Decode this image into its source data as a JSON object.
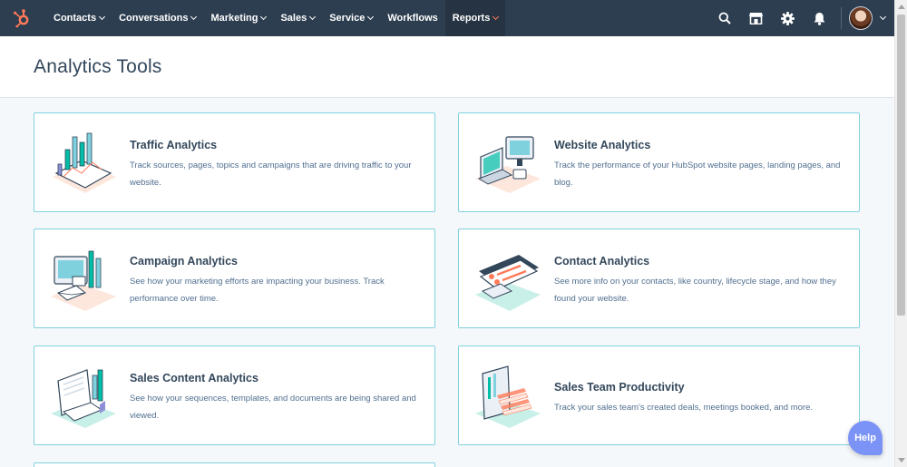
{
  "nav": {
    "logo_icon": "hubspot-sprocket-icon",
    "items": [
      {
        "label": "Contacts",
        "has_dropdown": true
      },
      {
        "label": "Conversations",
        "has_dropdown": true
      },
      {
        "label": "Marketing",
        "has_dropdown": true
      },
      {
        "label": "Sales",
        "has_dropdown": true
      },
      {
        "label": "Service",
        "has_dropdown": true
      },
      {
        "label": "Workflows",
        "has_dropdown": false
      },
      {
        "label": "Reports",
        "has_dropdown": true,
        "active": true
      }
    ],
    "right_icons": [
      "search-icon",
      "marketplace-icon",
      "settings-gear-icon",
      "notifications-bell-icon"
    ]
  },
  "page": {
    "title": "Analytics Tools"
  },
  "cards": [
    {
      "title": "Traffic Analytics",
      "description": "Track sources, pages, topics and campaigns that are driving traffic to your website.",
      "illustration": "traffic-analytics-illustration"
    },
    {
      "title": "Website Analytics",
      "description": "Track the performance of your HubSpot website pages, landing pages, and blog.",
      "illustration": "website-analytics-illustration"
    },
    {
      "title": "Campaign Analytics",
      "description": "See how your marketing efforts are impacting your business. Track performance over time.",
      "illustration": "campaign-analytics-illustration"
    },
    {
      "title": "Contact Analytics",
      "description": "See more info on your contacts, like country, lifecycle stage, and how they found your website.",
      "illustration": "contact-analytics-illustration"
    },
    {
      "title": "Sales Content Analytics",
      "description": "See how your sequences, templates, and documents are being shared and viewed.",
      "illustration": "sales-content-analytics-illustration"
    },
    {
      "title": "Sales Team Productivity",
      "description": "Track your sales team's created deals, meetings booked, and more.",
      "illustration": "sales-team-productivity-illustration"
    }
  ],
  "help": {
    "label": "Help"
  },
  "colors": {
    "nav_bg": "#2d3e50",
    "accent_orange": "#ff7a59",
    "card_border": "#7fd1de",
    "teal": "#00bda5",
    "help_bg": "#7b93f6"
  }
}
